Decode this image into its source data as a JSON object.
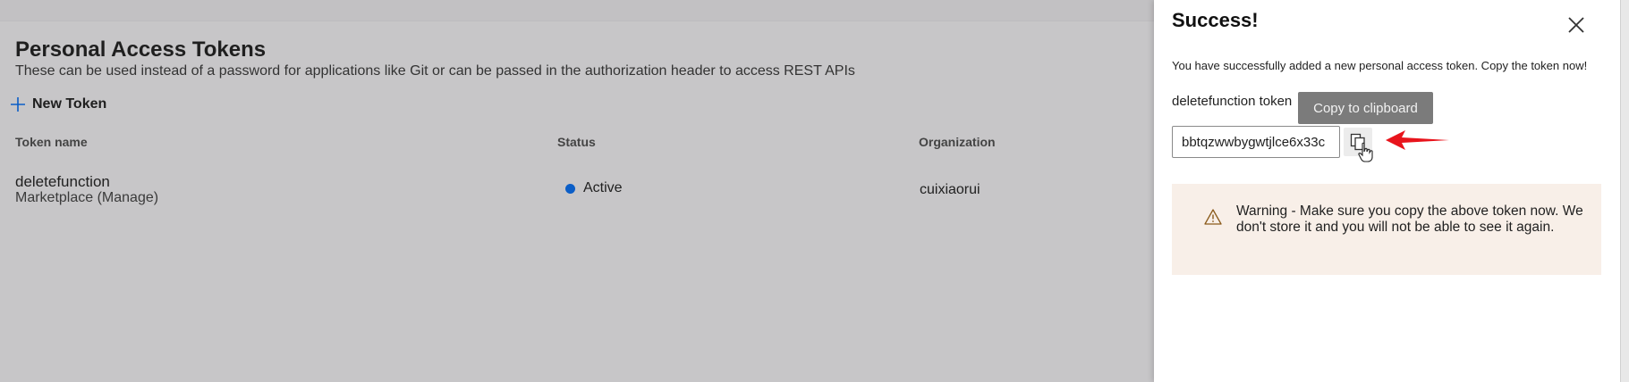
{
  "page": {
    "title": "Personal Access Tokens",
    "subtitle": "These can be used instead of a password for applications like Git or can be passed in the authorization header to access REST APIs",
    "new_token_label": "New Token"
  },
  "table": {
    "columns": [
      "Token name",
      "Status",
      "Organization"
    ],
    "rows": [
      {
        "name": "deletefunction",
        "scope": "Marketplace (Manage)",
        "status": "Active",
        "organization": "cuixiaorui"
      }
    ]
  },
  "panel": {
    "title": "Success!",
    "message": "You have successfully added a new personal access token. Copy the token now!",
    "token_label": "deletefunction token",
    "token_value": "bbtqzwwbygwtjlce6x33c",
    "tooltip": "Copy to clipboard",
    "warning": "Warning - Make sure you copy the above token now. We don't store it and you will not be able to see it again."
  },
  "colors": {
    "active_status": "#0b5ec7",
    "warning_bg": "#f8efe8",
    "annotation_arrow": "#e8141c"
  },
  "icons": [
    "plus-icon",
    "close-icon",
    "copy-icon",
    "hand-cursor-icon",
    "warning-icon",
    "red-arrow-annotation"
  ]
}
